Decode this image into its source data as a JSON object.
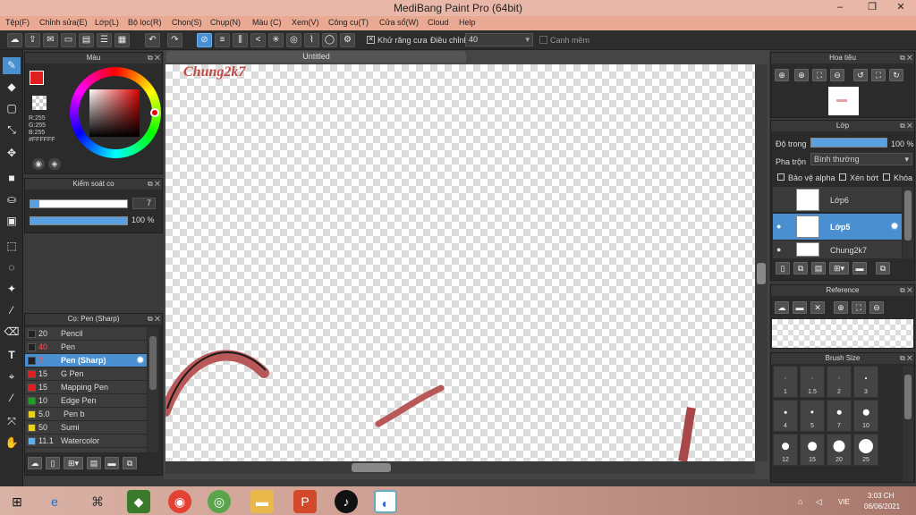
{
  "window": {
    "title": "MediBang Paint Pro (64bit)",
    "min": "–",
    "max": "❐",
    "close": "✕"
  },
  "menu": [
    "Tệp(F)",
    "Chỉnh sửa(E)",
    "Lớp(L)",
    "Bộ lọc(R)",
    "Chọn(S)",
    "Chụp(N)",
    "Màu (C)",
    "Xem(V)",
    "Công cụ(T)",
    "Cửa sổ(W)",
    "Cloud",
    "Help"
  ],
  "toolbar": {
    "antialias_label": "Khử răng cưa",
    "correction_label": "Điều chỉnh",
    "correction_value": "40",
    "edge_label": "Canh mềm"
  },
  "color_panel": {
    "title": "Màu",
    "r": "R:255",
    "g": "G:255",
    "b": "B:255",
    "hex": "#FFFFFF"
  },
  "brush_control": {
    "title": "Kiểm soát co",
    "size": "7",
    "opacity": "100 %",
    "size_fraction": 0.09,
    "opacity_fraction": 1.0
  },
  "brush_list": {
    "title": "Cọ: Pen (Sharp)",
    "items": [
      {
        "size": "20",
        "name": "Pencil",
        "color": "#222222"
      },
      {
        "size": "40",
        "name": "Pen",
        "color": "#222222",
        "size_red": true
      },
      {
        "size": "7",
        "name": "Pen (Sharp)",
        "color": "#222222",
        "selected": true,
        "size_red": true
      },
      {
        "size": "15",
        "name": "G Pen",
        "color": "#e02020"
      },
      {
        "size": "15",
        "name": "Mapping Pen",
        "color": "#e02020"
      },
      {
        "size": "10",
        "name": "Edge Pen",
        "color": "#20a020"
      },
      {
        "size": "5.0",
        "name": "Pen b",
        "color": "#e8d020"
      },
      {
        "size": "50",
        "name": "Sumi",
        "color": "#e8d020"
      },
      {
        "size": "11.1",
        "name": "Watercolor",
        "color": "#60b0e8"
      }
    ]
  },
  "canvas": {
    "tab": "Untitled",
    "watermark_text": "Chung2k7"
  },
  "navigator": {
    "title": "Hoa tiêu"
  },
  "layers": {
    "title": "Lớp",
    "opacity_label": "Độ trong",
    "opacity_value": "100 %",
    "opacity_fraction": 1.0,
    "blend_label": "Pha trộn",
    "blend_value": "Bình thường",
    "protect_alpha": "Bảo vệ alpha",
    "clipping": "Xén bớt",
    "lock": "Khóa",
    "items": [
      {
        "name": "Lớp6",
        "selected": false
      },
      {
        "name": "Lớp5",
        "selected": true
      },
      {
        "name": "Chung2k7",
        "selected": false
      }
    ]
  },
  "reference": {
    "title": "Reference"
  },
  "brush_size": {
    "title": "Brush Size",
    "sizes": [
      "1",
      "1.5",
      "2",
      "3",
      "4",
      "5",
      "7",
      "10",
      "12",
      "15",
      "20",
      "25"
    ]
  },
  "taskbar": {
    "lang": "VIE",
    "time": "3:03 CH",
    "date": "06/06/2021"
  }
}
